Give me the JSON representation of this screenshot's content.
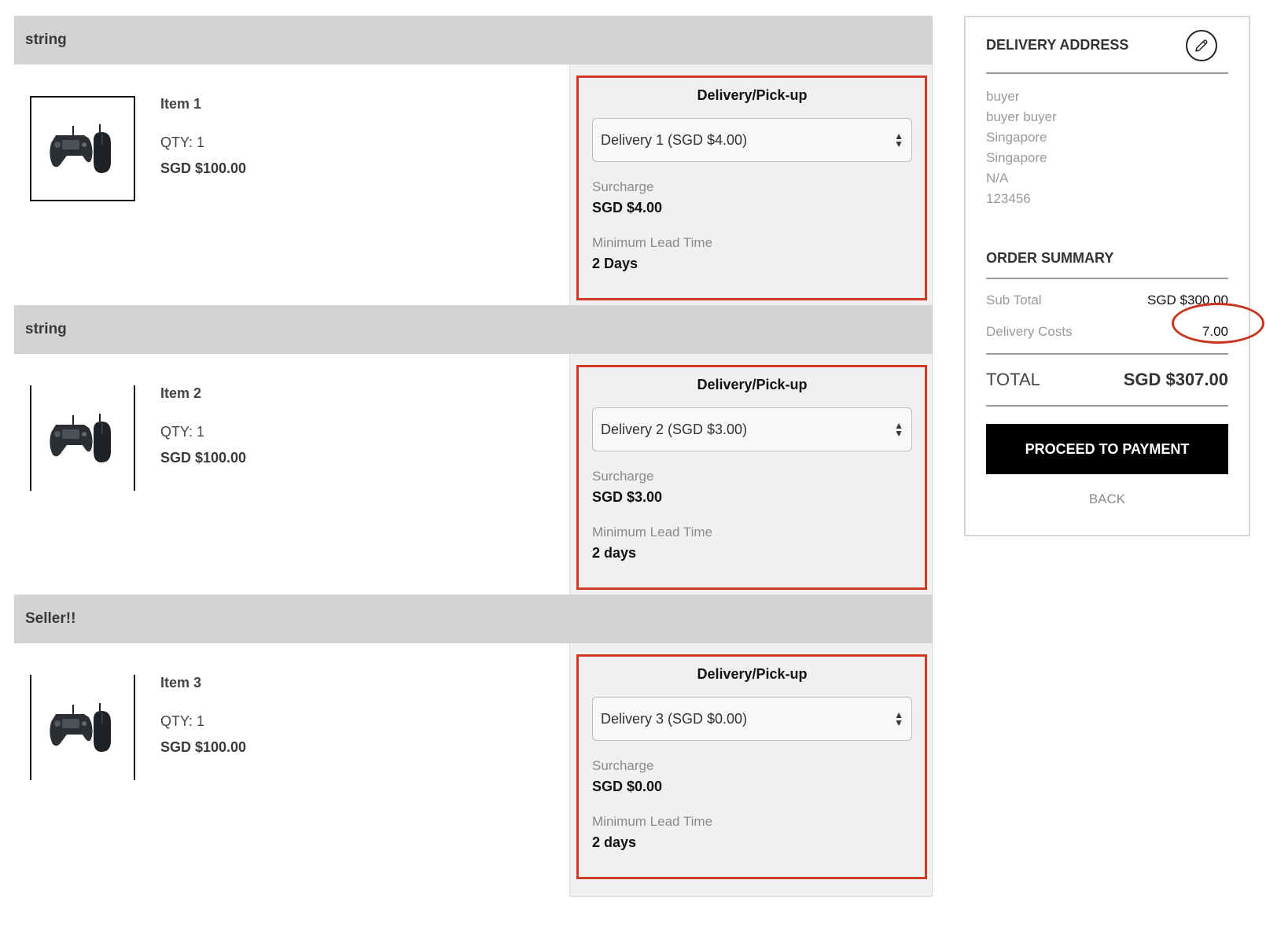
{
  "sellers": [
    {
      "name": "string",
      "item": {
        "name": "Item 1",
        "qty": "QTY: 1",
        "price": "SGD $100.00"
      },
      "delivery": {
        "title": "Delivery/Pick-up",
        "selected_option": "Delivery 1 (SGD $4.00)",
        "surcharge_label": "Surcharge",
        "surcharge_value": "SGD $4.00",
        "lead_time_label": "Minimum Lead Time",
        "lead_time_value": "2 Days"
      }
    },
    {
      "name": "string",
      "item": {
        "name": "Item 2",
        "qty": "QTY: 1",
        "price": "SGD $100.00"
      },
      "delivery": {
        "title": "Delivery/Pick-up",
        "selected_option": "Delivery 2 (SGD $3.00)",
        "surcharge_label": "Surcharge",
        "surcharge_value": "SGD $3.00",
        "lead_time_label": "Minimum Lead Time",
        "lead_time_value": "2 days"
      }
    },
    {
      "name": "Seller!!",
      "item": {
        "name": "Item 3",
        "qty": "QTY: 1",
        "price": "SGD $100.00"
      },
      "delivery": {
        "title": "Delivery/Pick-up",
        "selected_option": "Delivery 3 (SGD $0.00)",
        "surcharge_label": "Surcharge",
        "surcharge_value": "SGD $0.00",
        "lead_time_label": "Minimum Lead Time",
        "lead_time_value": "2 days"
      }
    }
  ],
  "sidebar": {
    "address_title": "DELIVERY ADDRESS",
    "edit_icon": "pencil-icon",
    "address_lines": [
      "buyer",
      "buyer buyer",
      "Singapore",
      "Singapore",
      "N/A",
      "123456"
    ],
    "summary_title": "ORDER SUMMARY",
    "subtotal_label": "Sub Total",
    "subtotal_value": "SGD $300.00",
    "delivery_costs_label": "Delivery Costs",
    "delivery_costs_value": "7.00",
    "total_label": "TOTAL",
    "total_value": "SGD $307.00",
    "proceed_label": "PROCEED TO PAYMENT",
    "back_label": "BACK"
  },
  "colors": {
    "highlight": "#d13a23",
    "header_bg": "#d3d3d3",
    "panel_bg": "#f0f0f0",
    "button_bg": "#000000"
  }
}
